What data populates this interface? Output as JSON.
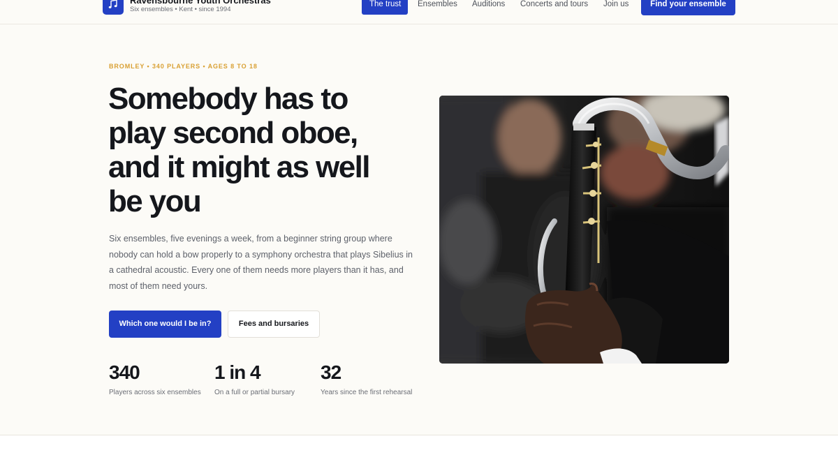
{
  "brand": {
    "name": "Ravensbourne Youth Orchestras",
    "tagline": "Six ensembles • Kent • since 1994",
    "logo_icon": "music-note-icon",
    "accent": "#2340c4"
  },
  "nav": {
    "items": [
      {
        "label": "The trust",
        "active": true
      },
      {
        "label": "Ensembles"
      },
      {
        "label": "Auditions"
      },
      {
        "label": "Concerts and tours"
      },
      {
        "label": "Join us"
      }
    ],
    "cta": "Find your ensemble"
  },
  "hero": {
    "eyebrow": "BROMLEY • 340 PLAYERS • AGES 8 TO 18",
    "headline": "Somebody has to play second oboe, and it might as well be you",
    "lede": "Six ensembles, five evenings a week, from a beginner string group where nobody can hold a bow properly to a symphony orchestra that plays Sibelius in a cathedral acoustic. Every one of them needs more players than it has, and most of them need yours.",
    "primary_button": "Which one would I be in?",
    "secondary_button": "Fees and bursaries",
    "stats": [
      {
        "value": "340",
        "label": "Players across six ensembles"
      },
      {
        "value": "1 in 4",
        "label": "On a full or partial bursary"
      },
      {
        "value": "32",
        "label": "Years since the first rehearsal"
      }
    ],
    "photo_subject": "bass-clarinet-player-photo"
  }
}
